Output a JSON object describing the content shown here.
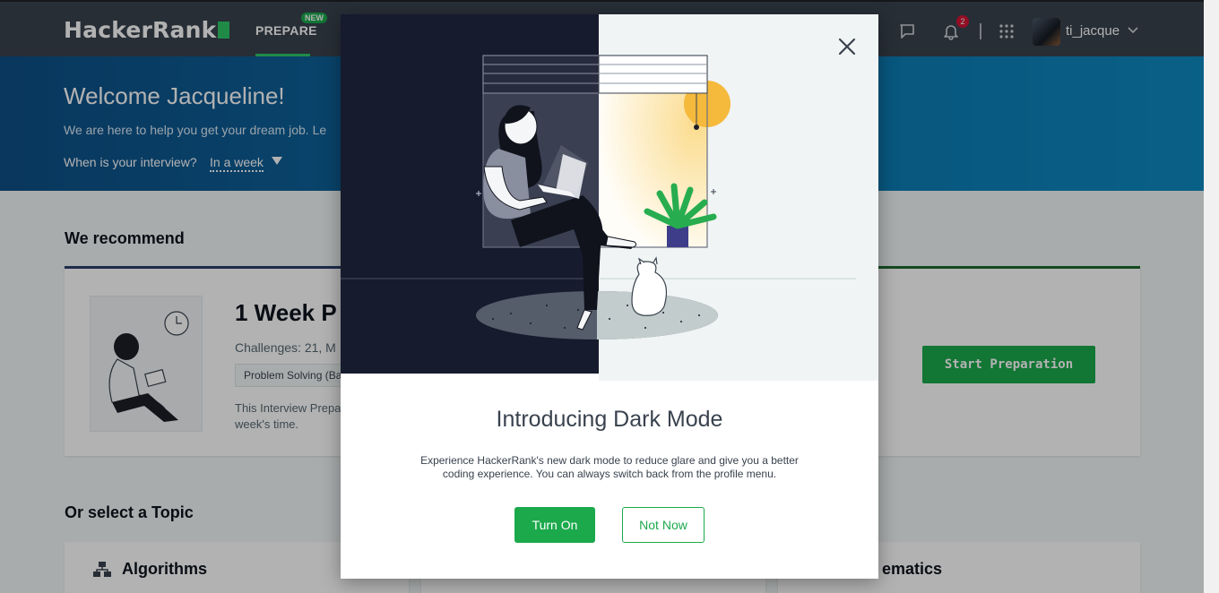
{
  "nav": {
    "logo": "HackerRank",
    "prepare": "PREPARE",
    "new_badge": "NEW",
    "notifications_count": "2",
    "username": "ti_jacque"
  },
  "hero": {
    "welcome": "Welcome Jacqueline!",
    "subtitle": "We are here to help you get your dream job. Le",
    "interview_question": "When is your interview?",
    "interview_value": "In a week"
  },
  "recommend": {
    "section_title": "We recommend",
    "card_title": "1 Week P",
    "challenges": "Challenges: 21, M",
    "tag": "Problem Solving (Ba",
    "description": "This Interview Prepa in a week's time.",
    "start_button": "Start Preparation"
  },
  "topics": {
    "section_title": "Or select a Topic",
    "algorithms": "Algorithms",
    "mathematics_partial": "ematics"
  },
  "modal": {
    "title": "Introducing Dark Mode",
    "body": "Experience HackerRank's new dark mode to reduce glare and give you a better coding experience. You can always switch back from the profile menu.",
    "turn_on": "Turn On",
    "not_now": "Not Now",
    "close_icon": "close-icon"
  },
  "colors": {
    "brand_green": "#1ba94c",
    "nav_dark": "#39424e",
    "hero_blue": "#0b76b0",
    "illus_dark": "#161b2e"
  }
}
